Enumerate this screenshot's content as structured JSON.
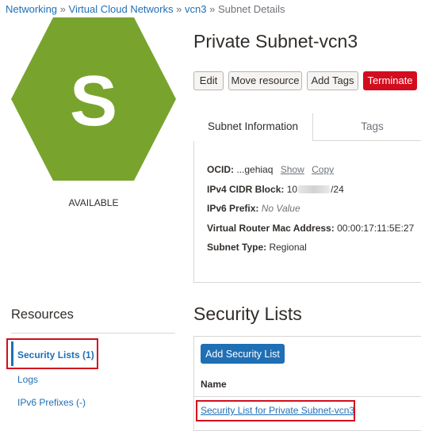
{
  "breadcrumb": {
    "items": [
      "Networking",
      "Virtual Cloud Networks",
      "vcn3"
    ],
    "separator": "»",
    "current": "Subnet Details"
  },
  "resource_icon": {
    "letter": "S",
    "color": "#78a42d",
    "status": "AVAILABLE"
  },
  "page_title": "Private Subnet-vcn3",
  "actions": {
    "edit": "Edit",
    "move": "Move resource",
    "add_tags": "Add Tags",
    "terminate": "Terminate"
  },
  "tabs": [
    "Subnet Information",
    "Tags"
  ],
  "subnet_info": {
    "ocid_label": "OCID:",
    "ocid_value": "...gehiaq",
    "show": "Show",
    "copy": "Copy",
    "cidr_label": "IPv4 CIDR Block:",
    "cidr_prefix": "10",
    "cidr_suffix": "/24",
    "ipv6_label": "IPv6 Prefix:",
    "ipv6_value": "No Value",
    "mac_label": "Virtual Router Mac Address:",
    "mac_value": "00:00:17:11:5E:27",
    "type_label": "Subnet Type:",
    "type_value": "Regional"
  },
  "resources": {
    "title": "Resources",
    "items": [
      "Security Lists (1)",
      "Logs",
      "IPv6 Prefixes (-)"
    ]
  },
  "security_lists": {
    "title": "Security Lists",
    "add_button": "Add Security List",
    "column_name": "Name",
    "rows": [
      "Security List for Private Subnet-vcn3"
    ]
  },
  "colors": {
    "link": "#1f6fb5",
    "danger": "#d30d1e",
    "icon_green": "#78a42d"
  }
}
